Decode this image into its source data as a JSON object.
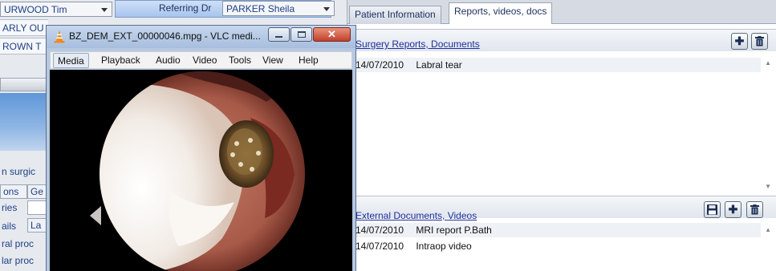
{
  "left": {
    "patient_combo": "URWOOD Tim",
    "referring_label": "Referring Dr",
    "referring_field": "PARKER Sheila",
    "row2": "ARLY OU",
    "row3": "ROWN T",
    "surgical_label": "n surgic",
    "tab_a": "ons",
    "tab_b": "Ge",
    "series_label": "ries",
    "details_label": "ails",
    "details_tab": "La",
    "proc1": "ral proc",
    "proc2": "lar proc"
  },
  "tabs": [
    "Patient Information",
    "Reports, videos, docs"
  ],
  "surgery": {
    "title": "Surgery Reports, Documents",
    "rows": [
      {
        "date": "14/07/2010",
        "label": "Labral tear"
      }
    ]
  },
  "external": {
    "title": "External Documents, Videos",
    "rows": [
      {
        "date": "14/07/2010",
        "label": "MRI report P.Bath"
      },
      {
        "date": "14/07/2010",
        "label": "Intraop video"
      }
    ]
  },
  "vlc": {
    "title": "BZ_DEM_EXT_00000046.mpg - VLC medi...",
    "menu": [
      "Media",
      "Playback",
      "Audio",
      "Video",
      "Tools",
      "View",
      "Help"
    ],
    "active_menu": "Media"
  },
  "icons": {
    "add": "plus-icon",
    "delete": "trash-icon",
    "save": "floppy-disk-icon",
    "vlc": "vlc-cone-icon"
  },
  "colors": {
    "link": "#1d2f9a",
    "close_button": "#c2402a",
    "title_bar": "#b6c9e2"
  }
}
